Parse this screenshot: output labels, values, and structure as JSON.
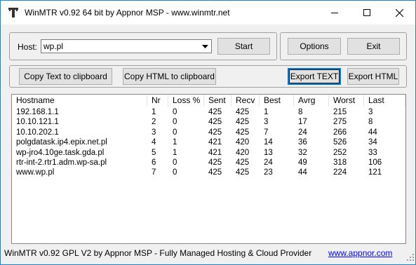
{
  "window": {
    "title": "WinMTR v0.92 64 bit by Appnor MSP - www.winmtr.net",
    "icon": "winmtr-app-icon",
    "controls": [
      "minimize-icon",
      "maximize-icon",
      "close-icon"
    ]
  },
  "host": {
    "label": "Host:",
    "value": "wp.pl",
    "start_label": "Start"
  },
  "toolbar": {
    "options_label": "Options",
    "exit_label": "Exit",
    "copy_text_label": "Copy Text to clipboard",
    "copy_html_label": "Copy HTML to clipboard",
    "export_text_label": "Export TEXT",
    "export_html_label": "Export HTML"
  },
  "table": {
    "columns": [
      "Hostname",
      "Nr",
      "Loss %",
      "Sent",
      "Recv",
      "Best",
      "Avrg",
      "Worst",
      "Last"
    ],
    "rows": [
      [
        "192.168.1.1",
        "1",
        "0",
        "425",
        "425",
        "1",
        "8",
        "215",
        "3"
      ],
      [
        "10.10.121.1",
        "2",
        "0",
        "425",
        "425",
        "3",
        "17",
        "275",
        "8"
      ],
      [
        "10.10.202.1",
        "3",
        "0",
        "425",
        "425",
        "7",
        "24",
        "266",
        "44"
      ],
      [
        "polgdatask.ip4.epix.net.pl",
        "4",
        "1",
        "421",
        "420",
        "14",
        "36",
        "526",
        "34"
      ],
      [
        "wp-jro4.10ge.task.gda.pl",
        "5",
        "1",
        "421",
        "420",
        "13",
        "32",
        "252",
        "33"
      ],
      [
        "rtr-int-2.rtr1.adm.wp-sa.pl",
        "6",
        "0",
        "425",
        "425",
        "24",
        "49",
        "318",
        "106"
      ],
      [
        "www.wp.pl",
        "7",
        "0",
        "425",
        "425",
        "23",
        "44",
        "224",
        "121"
      ]
    ]
  },
  "status": {
    "text": "WinMTR v0.92 GPL V2 by Appnor MSP - Fully Managed Hosting & Cloud Provider",
    "link": "www.appnor.com"
  },
  "colors": {
    "window_border": "#1883d7",
    "default_button_border": "#0078d7",
    "link": "#0000ff"
  }
}
